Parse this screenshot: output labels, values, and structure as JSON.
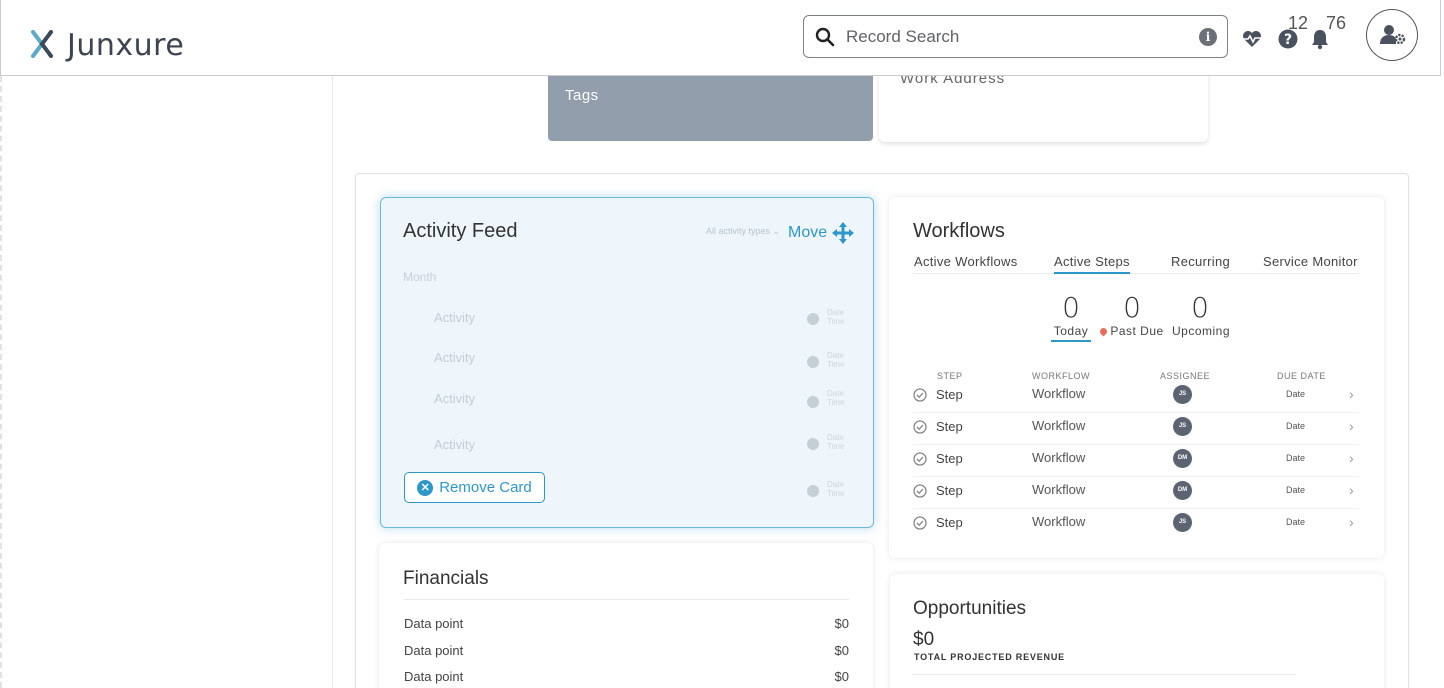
{
  "header": {
    "logo_text": "Junxure",
    "search_placeholder": "Record Search",
    "help_count": "12",
    "notification_count": "76"
  },
  "top_cards": {
    "tags_label": "Tags",
    "address_label": "Work Address"
  },
  "activity_feed": {
    "title": "Activity Feed",
    "filter_label": "All activity types",
    "move_label": "Move",
    "month_label": "Month",
    "items": [
      {
        "label": "Activity",
        "date_top": "Date",
        "date_bottom": "Time"
      },
      {
        "label": "Activity",
        "date_top": "Date",
        "date_bottom": "Time"
      },
      {
        "label": "Activity",
        "date_top": "Date",
        "date_bottom": "Time"
      },
      {
        "label": "Activity",
        "date_top": "Date",
        "date_bottom": "Time"
      },
      {
        "label": "",
        "date_top": "Date",
        "date_bottom": "Time"
      }
    ],
    "remove_label": "Remove Card"
  },
  "workflows": {
    "title": "Workflows",
    "tabs": [
      {
        "label": "Active Workflows"
      },
      {
        "label": "Active Steps"
      },
      {
        "label": "Recurring"
      },
      {
        "label": "Service Monitor"
      }
    ],
    "stats": [
      {
        "value": "0",
        "label": "Today"
      },
      {
        "value": "0",
        "label": "Past Due"
      },
      {
        "value": "0",
        "label": "Upcoming"
      }
    ],
    "columns": {
      "step": "STEP",
      "workflow": "WORKFLOW",
      "assignee": "ASSIGNEE",
      "due_date": "DUE DATE"
    },
    "rows": [
      {
        "step": "Step",
        "workflow": "Workflow",
        "assignee": "JS",
        "date": "Date"
      },
      {
        "step": "Step",
        "workflow": "Workflow",
        "assignee": "JS",
        "date": "Date"
      },
      {
        "step": "Step",
        "workflow": "Workflow",
        "assignee": "DM",
        "date": "Date"
      },
      {
        "step": "Step",
        "workflow": "Workflow",
        "assignee": "DM",
        "date": "Date"
      },
      {
        "step": "Step",
        "workflow": "Workflow",
        "assignee": "JS",
        "date": "Date"
      }
    ]
  },
  "financials": {
    "title": "Financials",
    "rows": [
      {
        "label": "Data point",
        "value": "$0"
      },
      {
        "label": "Data point",
        "value": "$0"
      },
      {
        "label": "Data point",
        "value": "$0"
      }
    ]
  },
  "opportunities": {
    "title": "Opportunities",
    "amount": "$0",
    "sub_label": "TOTAL PROJECTED REVENUE"
  },
  "colors": {
    "accent": "#2e97c9",
    "tags_bg": "#929eab",
    "avatar_bg": "#5b6470"
  }
}
